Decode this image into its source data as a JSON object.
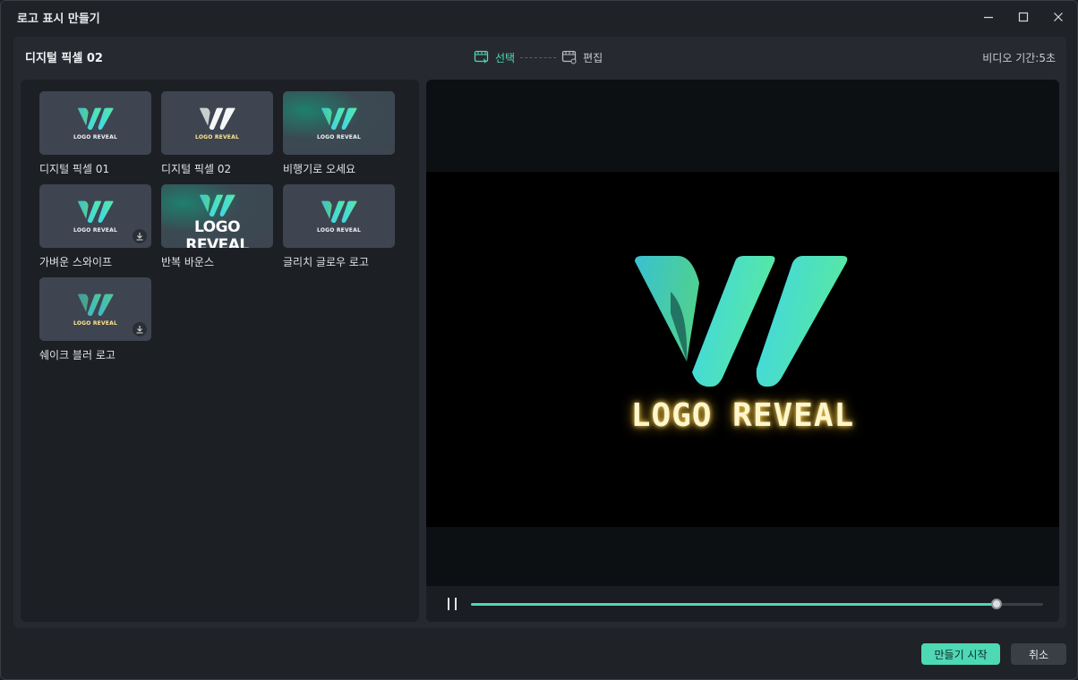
{
  "window": {
    "title": "로고 표시 만들기",
    "controls": {
      "minimize": "minimize-icon",
      "maximize": "maximize-icon",
      "close": "close-icon"
    }
  },
  "header": {
    "preset_name": "디지털 픽셀 02",
    "steps": [
      {
        "label": "선택",
        "icon": "select-film-icon",
        "active": true
      },
      {
        "label": "편집",
        "icon": "edit-film-icon",
        "active": false
      }
    ],
    "duration": "비디오 기간:5초"
  },
  "presets": [
    {
      "name": "디지털 픽셀 01",
      "style": "plain",
      "thumb_text": "LOGO REVEAL",
      "download": false
    },
    {
      "name": "디지털 픽셀 02",
      "style": "plain",
      "thumb_text": "LOGO REVEAL",
      "download": false
    },
    {
      "name": "비행기로 오세요",
      "style": "glow",
      "thumb_text": "LOGO REVEAL",
      "download": false
    },
    {
      "name": "가벼운 스와이프",
      "style": "plain",
      "thumb_text": "LOGO REVEAL",
      "download": true
    },
    {
      "name": "반복 바운스",
      "style": "big",
      "thumb_text": "LOGO REVEAL",
      "download": false
    },
    {
      "name": "글리치 글로우 로고",
      "style": "plain",
      "thumb_text": "LOGO REVEAL",
      "download": false
    },
    {
      "name": "쉐이크 블러 로고",
      "style": "yellow",
      "thumb_text": "LOGO REVEAL",
      "download": true
    }
  ],
  "preview": {
    "text": "LOGO REVEAL",
    "progress": 0.919,
    "play_state": "pause-icon"
  },
  "footer": {
    "create_label": "만들기 시작",
    "cancel_label": "취소"
  },
  "colors": {
    "accent": "#4dd9b4",
    "logo_gradient_start": "#3fd6e8",
    "logo_gradient_end": "#58e8a0",
    "glow_text": "#fff6cc"
  }
}
